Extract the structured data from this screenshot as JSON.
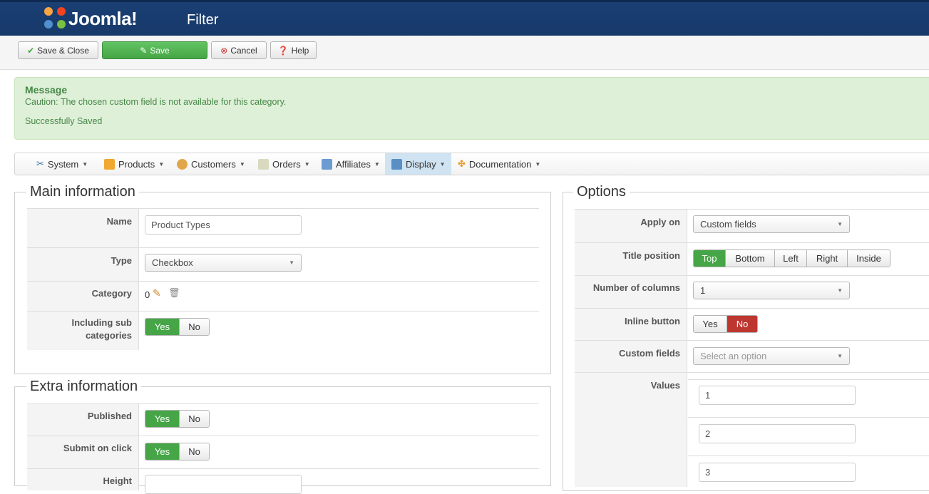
{
  "header": {
    "logo_text": "Joomla!",
    "title": "Filter"
  },
  "toolbar": {
    "save_close": "Save & Close",
    "save": "Save",
    "cancel": "Cancel",
    "help": "Help"
  },
  "message": {
    "heading": "Message",
    "line1": "Caution: The chosen custom field is not available for this category.",
    "line2": "Successfully Saved"
  },
  "menu": [
    {
      "label": "System",
      "icon": "tools-icon"
    },
    {
      "label": "Products",
      "icon": "products-icon"
    },
    {
      "label": "Customers",
      "icon": "customers-icon"
    },
    {
      "label": "Orders",
      "icon": "orders-icon"
    },
    {
      "label": "Affiliates",
      "icon": "affiliates-icon"
    },
    {
      "label": "Display",
      "icon": "display-icon",
      "active": true
    },
    {
      "label": "Documentation",
      "icon": "documentation-icon"
    }
  ],
  "main_info": {
    "legend": "Main information",
    "name_label": "Name",
    "name_value": "Product Types",
    "type_label": "Type",
    "type_value": "Checkbox",
    "category_label": "Category",
    "category_value": "0",
    "sub_label_1": "Including sub",
    "sub_label_2": "categories",
    "yes": "Yes",
    "no": "No"
  },
  "extra_info": {
    "legend": "Extra information",
    "published_label": "Published",
    "submit_label": "Submit on click",
    "height_label": "Height",
    "yes": "Yes",
    "no": "No"
  },
  "options": {
    "legend": "Options",
    "apply_on_label": "Apply on",
    "apply_on_value": "Custom fields",
    "title_position_label": "Title position",
    "title_positions": [
      "Top",
      "Bottom",
      "Left",
      "Right",
      "Inside"
    ],
    "columns_label": "Number of columns",
    "columns_value": "1",
    "inline_label": "Inline button",
    "yes": "Yes",
    "no": "No",
    "custom_fields_label": "Custom fields",
    "custom_fields_placeholder": "Select an option",
    "values_label": "Values",
    "values": [
      "1",
      "2",
      "3"
    ]
  },
  "colors": {
    "header": "#17396a",
    "green": "#46a546",
    "red": "#bd362f",
    "message_bg": "#dff0d8"
  }
}
